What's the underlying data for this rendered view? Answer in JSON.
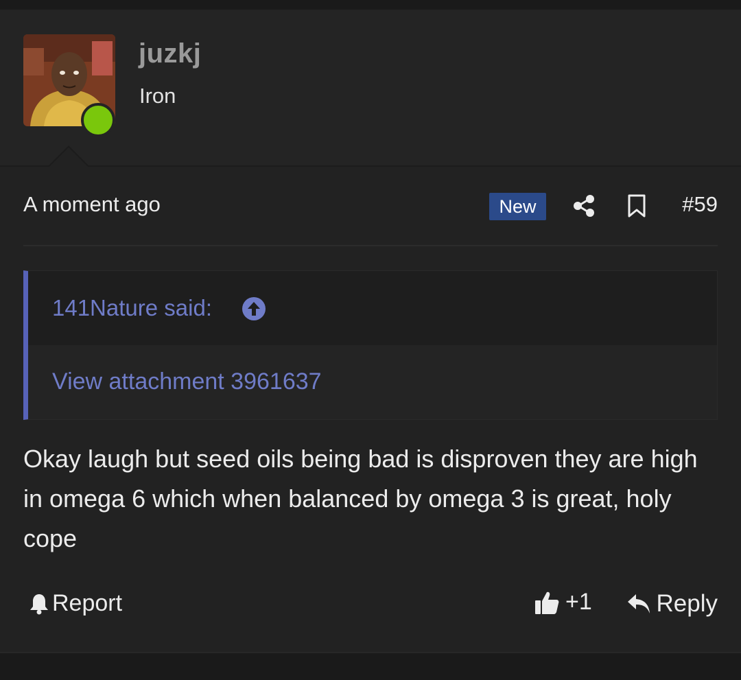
{
  "post": {
    "user": {
      "username": "juzkj",
      "title": "Iron",
      "online": true
    },
    "meta": {
      "timestamp": "A moment ago",
      "new_badge": "New",
      "post_number": "#59"
    },
    "quote": {
      "author_label": "141Nature said:",
      "attachment_link": "View attachment 3961637"
    },
    "message": "Okay laugh but seed oils being bad is disproven they are high in omega 6 which when balanced by omega 3 is great, holy cope",
    "actions": {
      "report_label": "Report",
      "like_count": "+1",
      "reply_label": "Reply"
    }
  },
  "colors": {
    "background": "#1e1e1e",
    "accent_link": "#6f7cc8",
    "quote_border": "#5762b8",
    "new_badge": "#2b4a8a",
    "online": "#7ac70c"
  },
  "icons": [
    "share-icon",
    "bookmark-icon",
    "arrow-up-circle-icon",
    "bell-icon",
    "thumbs-up-icon",
    "reply-icon"
  ]
}
